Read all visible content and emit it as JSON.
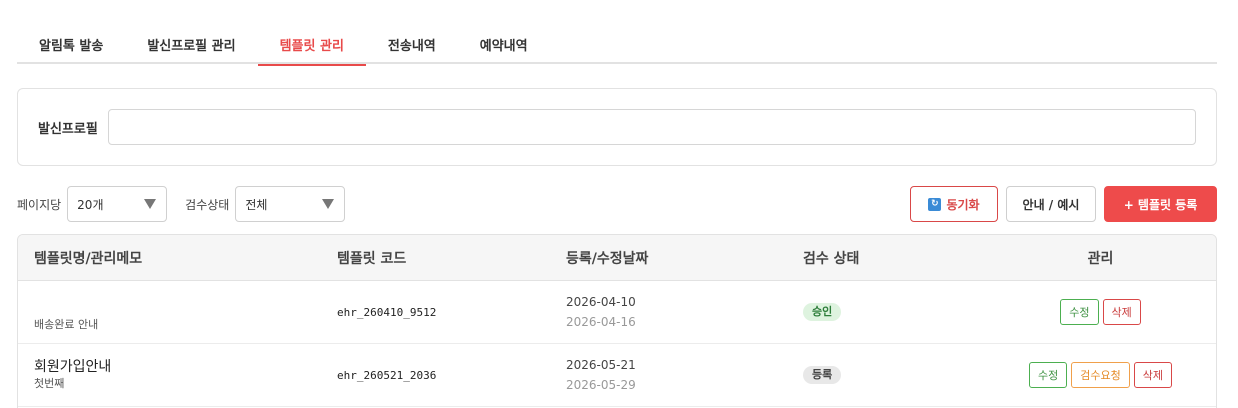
{
  "tabs": [
    {
      "label": "알림톡 발송",
      "active": false
    },
    {
      "label": "발신프로필 관리",
      "active": false
    },
    {
      "label": "템플릿 관리",
      "active": true
    },
    {
      "label": "전송내역",
      "active": false
    },
    {
      "label": "예약내역",
      "active": false
    }
  ],
  "profile": {
    "label": "발신프로필",
    "value": ""
  },
  "controls": {
    "per_page_label": "페이지당",
    "per_page_value": "20개",
    "status_label": "검수상태",
    "status_value": "전체",
    "sync_label": "동기화",
    "guide_label": "안내 / 예시",
    "add_label": "+ 템플릿 등록"
  },
  "colors": {
    "accent": "#e84a4a",
    "approved": "#2d7d3a",
    "review": "#e58a26",
    "sync_icon": "#3a8bd6"
  },
  "table": {
    "headers": [
      "템플릿명/관리메모",
      "템플릿 코드",
      "등록/수정날짜",
      "검수 상태",
      "관리"
    ],
    "rows": [
      {
        "name": "",
        "memo": "배송완료 안내",
        "code": "ehr_260410_9512",
        "created": "2026-04-10",
        "updated": "2026-04-16",
        "status": "승인",
        "actions": {
          "edit": "수정",
          "delete": "삭제"
        }
      },
      {
        "name": "회원가입안내",
        "memo": "첫번째",
        "code": "ehr_260521_2036",
        "created": "2026-05-21",
        "updated": "2026-05-29",
        "status": "등록",
        "actions": {
          "edit": "수정",
          "review": "검수요청",
          "delete": "삭제"
        }
      }
    ]
  }
}
